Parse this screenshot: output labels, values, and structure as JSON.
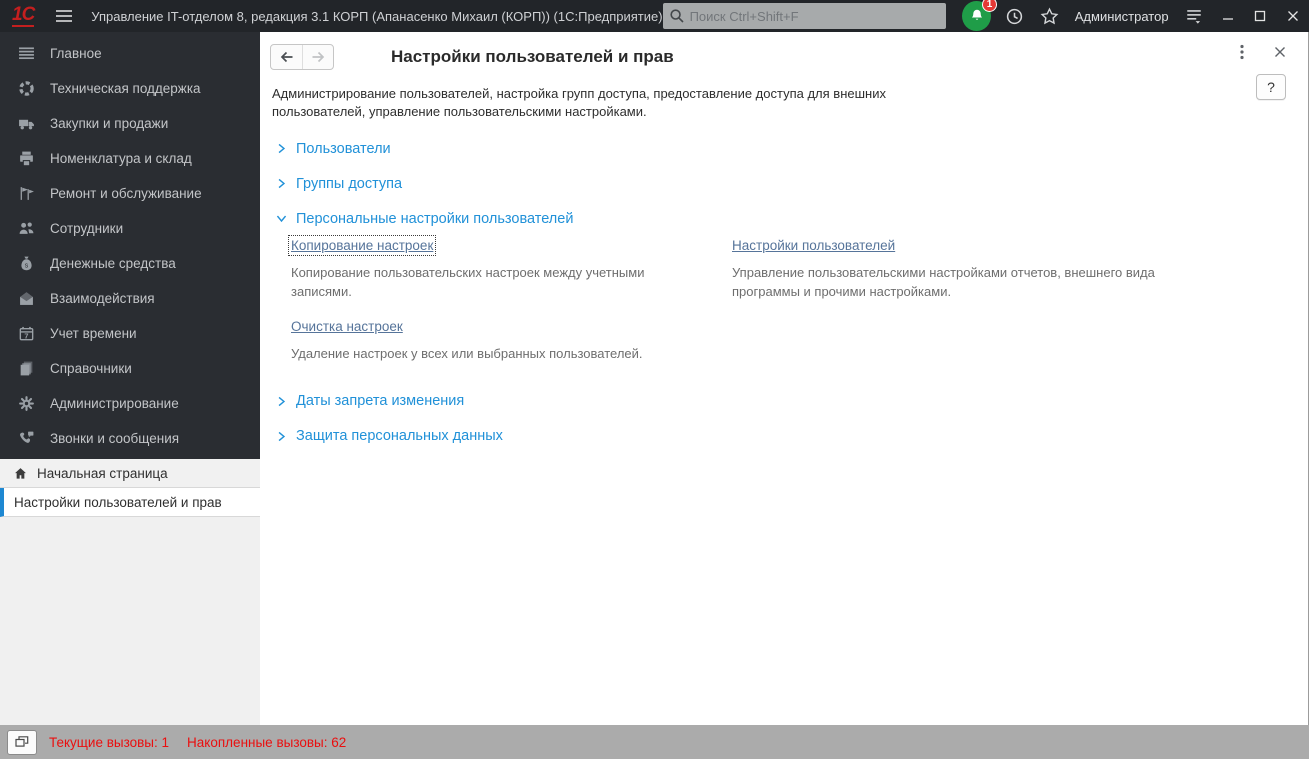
{
  "titlebar": {
    "logo": "1С",
    "window_title": "Управление IT-отделом 8, редакция 3.1 КОРП (Апанасенко Михаил (КОРП))  (1С:Предприятие)",
    "search_placeholder": "Поиск Ctrl+Shift+F",
    "notification_count": "1",
    "user": "Администратор"
  },
  "sidebar": {
    "items": [
      {
        "label": "Главное",
        "icon": "menu-lines-icon"
      },
      {
        "label": "Техническая поддержка",
        "icon": "lifering-icon"
      },
      {
        "label": "Закупки и продажи",
        "icon": "truck-icon"
      },
      {
        "label": "Номенклатура и склад",
        "icon": "printer-icon"
      },
      {
        "label": "Ремонт и обслуживание",
        "icon": "flags-icon"
      },
      {
        "label": "Сотрудники",
        "icon": "employees-icon"
      },
      {
        "label": "Денежные средства",
        "icon": "money-bag-icon"
      },
      {
        "label": "Взаимодействия",
        "icon": "mail-icon"
      },
      {
        "label": "Учет времени",
        "icon": "calendar-icon"
      },
      {
        "label": "Справочники",
        "icon": "books-icon"
      },
      {
        "label": "Администрирование",
        "icon": "gear-icon"
      },
      {
        "label": "Звонки и сообщения",
        "icon": "phone-message-icon"
      }
    ],
    "home_tab": "Начальная страница",
    "active_tab": "Настройки пользователей и прав"
  },
  "content": {
    "title": "Настройки пользователей и прав",
    "description": "Администрирование пользователей, настройка групп доступа, предоставление доступа для внешних пользователей, управление пользовательскими настройками.",
    "help_label": "?",
    "sections": [
      {
        "label": "Пользователи",
        "state": "collapsed"
      },
      {
        "label": "Группы доступа",
        "state": "collapsed"
      },
      {
        "label": "Персональные настройки пользователей",
        "state": "expanded",
        "links": [
          {
            "label": "Копирование настроек",
            "description": "Копирование пользовательских настроек между учетными записями.",
            "focused": true
          },
          {
            "label": "Настройки пользователей",
            "description": "Управление пользовательскими настройками отчетов, внешнего вида программы и прочими настройками.",
            "focused": false
          },
          {
            "label": "Очистка настроек",
            "description": "Удаление настроек у всех или выбранных пользователей.",
            "focused": false
          }
        ]
      },
      {
        "label": "Даты запрета изменения",
        "state": "collapsed"
      },
      {
        "label": "Защита персональных данных",
        "state": "collapsed"
      }
    ]
  },
  "statusbar": {
    "current_calls_label": "Текущие вызовы:",
    "current_calls_value": "1",
    "accumulated_calls_label": "Накопленные вызовы:",
    "accumulated_calls_value": "62"
  },
  "colors": {
    "titlebar_bg": "#222529",
    "sidebar_bg": "#2a2d32",
    "accent_blue": "#2191d8",
    "active_tab_marker": "#1e88d2",
    "link_color": "#56749a",
    "status_red": "#ea0f0f",
    "notification_green": "#1f9d48",
    "badge_red": "#e53935",
    "statusbar_bg": "#ababab"
  }
}
